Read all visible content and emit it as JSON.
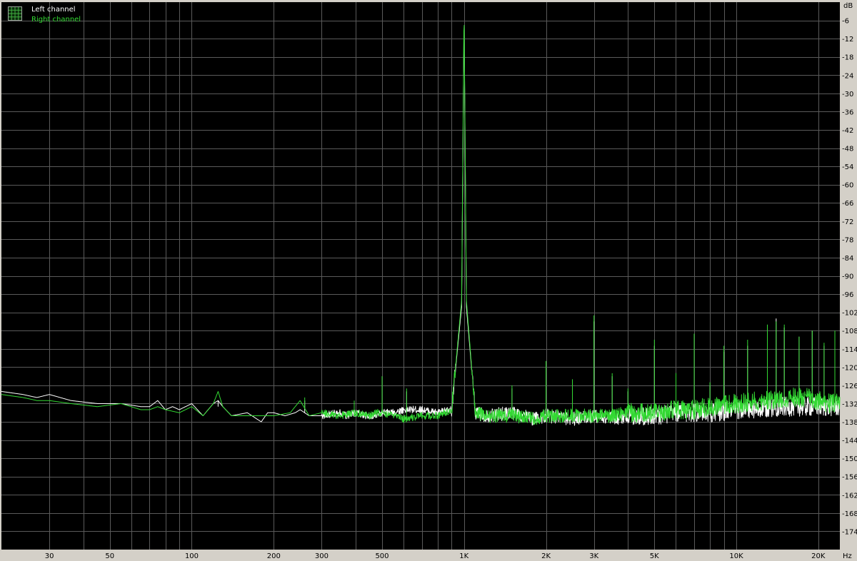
{
  "chart_data": {
    "type": "line",
    "xscale": "log",
    "xlim": [
      20,
      24000
    ],
    "ylim": [
      -180,
      0
    ],
    "grid": true,
    "legend_position": "top-left",
    "y_unit": "dB",
    "x_unit": "Hz",
    "y_ticks": [
      -6,
      -12,
      -18,
      -24,
      -30,
      -36,
      -42,
      -48,
      -54,
      -60,
      -66,
      -72,
      -78,
      -84,
      -90,
      -96,
      -102,
      -108,
      -114,
      -120,
      -126,
      -132,
      -138,
      -144,
      -150,
      -156,
      -162,
      -168,
      -174
    ],
    "x_ticks": [
      {
        "value": 30,
        "label": "30"
      },
      {
        "value": 50,
        "label": "50"
      },
      {
        "value": 100,
        "label": "100"
      },
      {
        "value": 200,
        "label": "200"
      },
      {
        "value": 300,
        "label": "300"
      },
      {
        "value": 500,
        "label": "500"
      },
      {
        "value": 1000,
        "label": "1K"
      },
      {
        "value": 2000,
        "label": "2K"
      },
      {
        "value": 3000,
        "label": "3K"
      },
      {
        "value": 5000,
        "label": "5K"
      },
      {
        "value": 10000,
        "label": "10K"
      },
      {
        "value": 20000,
        "label": "20K"
      }
    ],
    "series": [
      {
        "name": "Left channel",
        "color": "#ffffff",
        "x": [
          20,
          24,
          27,
          30,
          36,
          45,
          55,
          65,
          70,
          75,
          80,
          85,
          90,
          100,
          110,
          120,
          125,
          130,
          140,
          160,
          180,
          190,
          200,
          220,
          240,
          250,
          270,
          300,
          350,
          370,
          400,
          440,
          480,
          500,
          550,
          600,
          700,
          800,
          900,
          980,
          1000,
          1020,
          1100,
          1200,
          1500,
          1800,
          2000,
          2500,
          3000,
          3500,
          4000,
          5000,
          6000,
          7000,
          8000,
          10000,
          12000,
          14000,
          16000,
          18000,
          20000,
          22000,
          24000
        ],
        "y": [
          -128,
          -129,
          -130,
          -129,
          -131,
          -132,
          -132,
          -133,
          -133,
          -131,
          -134,
          -133,
          -134,
          -132,
          -136,
          -132,
          -131,
          -133,
          -136,
          -135,
          -138,
          -135,
          -135,
          -136,
          -135,
          -134,
          -136,
          -136,
          -135,
          -136,
          -135,
          -136,
          -136,
          -135,
          -135,
          -134,
          -134,
          -135,
          -134,
          -100,
          -4,
          -100,
          -135,
          -136,
          -135,
          -137,
          -136,
          -137,
          -136,
          -137,
          -136,
          -136,
          -135,
          -135,
          -135,
          -134,
          -134,
          -133,
          -133,
          -133,
          -133,
          -133,
          -133
        ]
      },
      {
        "name": "Right channel",
        "color": "#33d933",
        "x": [
          20,
          24,
          27,
          30,
          36,
          45,
          55,
          65,
          70,
          75,
          80,
          90,
          100,
          110,
          115,
          120,
          125,
          130,
          140,
          160,
          180,
          190,
          200,
          230,
          250,
          270,
          300,
          350,
          400,
          450,
          480,
          500,
          550,
          600,
          700,
          800,
          900,
          980,
          1000,
          1020,
          1100,
          1200,
          1500,
          1800,
          2000,
          2500,
          3000,
          3500,
          4000,
          5000,
          6000,
          7000,
          8000,
          10000,
          12000,
          14000,
          16000,
          18000,
          20000,
          22000,
          24000
        ],
        "y": [
          -129,
          -130,
          -131,
          -131,
          -132,
          -133,
          -132,
          -134,
          -134,
          -133,
          -134,
          -135,
          -133,
          -136,
          -134,
          -132,
          -128,
          -133,
          -136,
          -136,
          -136,
          -136,
          -136,
          -135,
          -131,
          -136,
          -135,
          -136,
          -135,
          -136,
          -135,
          -135,
          -136,
          -137,
          -136,
          -136,
          -134,
          -98,
          -2,
          -98,
          -135,
          -136,
          -136,
          -137,
          -136,
          -136,
          -136,
          -136,
          -135,
          -135,
          -134,
          -134,
          -133,
          -132,
          -131,
          -131,
          -130,
          -130,
          -131,
          -132,
          -132
        ]
      }
    ],
    "harmonics": [
      {
        "freq": 125,
        "left": -133,
        "right": -128
      },
      {
        "freq": 260,
        "left": -131,
        "right": -130
      },
      {
        "freq": 395,
        "left": -134,
        "right": -131
      },
      {
        "freq": 500,
        "left": -124,
        "right": -123
      },
      {
        "freq": 615,
        "left": -128,
        "right": -127
      },
      {
        "freq": 1500,
        "left": -127,
        "right": -126
      },
      {
        "freq": 2000,
        "left": -122,
        "right": -118
      },
      {
        "freq": 2500,
        "left": -126,
        "right": -124
      },
      {
        "freq": 3000,
        "left": -105,
        "right": -103
      },
      {
        "freq": 3500,
        "left": -123,
        "right": -122
      },
      {
        "freq": 4000,
        "left": -128,
        "right": -127
      },
      {
        "freq": 5000,
        "left": -113,
        "right": -111
      },
      {
        "freq": 6000,
        "left": -122,
        "right": -122
      },
      {
        "freq": 7000,
        "left": -110,
        "right": -109
      },
      {
        "freq": 8000,
        "left": -126,
        "right": -125
      },
      {
        "freq": 9000,
        "left": -115,
        "right": -113
      },
      {
        "freq": 11000,
        "left": -113,
        "right": -111
      },
      {
        "freq": 13000,
        "left": -107,
        "right": -106
      },
      {
        "freq": 14000,
        "left": -104,
        "right": -105
      },
      {
        "freq": 15000,
        "left": -107,
        "right": -106
      },
      {
        "freq": 17000,
        "left": -110,
        "right": -110
      },
      {
        "freq": 19000,
        "left": -108,
        "right": -108
      },
      {
        "freq": 21000,
        "left": -113,
        "right": -112
      },
      {
        "freq": 23000,
        "left": -109,
        "right": -108
      }
    ]
  },
  "legend_icon": "grid-icon",
  "colors": {
    "plot_background": "#000000",
    "grid": "#5a5a5a",
    "frame": "#d4d0c8",
    "left_channel": "#ffffff",
    "right_channel": "#33d933"
  }
}
